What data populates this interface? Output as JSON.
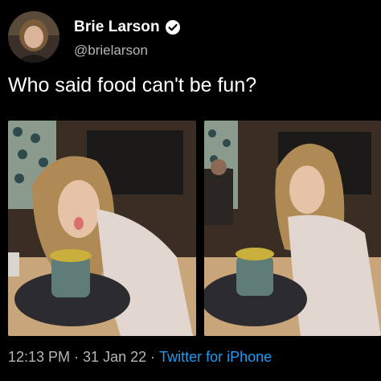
{
  "author": {
    "display_name": "Brie Larson",
    "handle": "@brielarson",
    "verified": true,
    "avatar_icon": "profile-photo"
  },
  "tweet": {
    "text": "Who said food can't be fun?"
  },
  "media": [
    {
      "type": "photo"
    },
    {
      "type": "photo"
    }
  ],
  "footer": {
    "time": "12:13 PM",
    "separator": "·",
    "date": "31 Jan 22",
    "source": "Twitter for iPhone"
  },
  "colors": {
    "background": "#000000",
    "text_primary": "#ffffff",
    "text_secondary": "#b6b6b6",
    "accent": "#1d9bf0"
  }
}
